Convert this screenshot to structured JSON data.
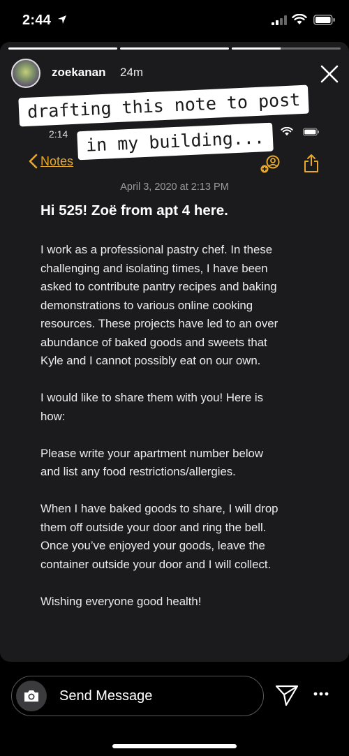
{
  "status_bar": {
    "time": "2:44"
  },
  "story": {
    "progress": [
      1.0,
      1.0,
      0.45
    ],
    "username": "zoekanan",
    "time_ago": "24m",
    "stickers": [
      "drafting this note to post",
      "in my building..."
    ]
  },
  "inner_screen": {
    "time": "2:14",
    "back_label": "Notes",
    "date": "April 3, 2020 at 2:13 PM",
    "title": "Hi 525! Zoë from apt 4 here.",
    "paragraphs": [
      "I work as a professional pastry chef. In these\nchallenging and isolating times, I have been\nasked to contribute pantry recipes and baking\ndemonstrations to various online cooking\nresources. These projects have led to an over\nabundance of baked goods and sweets that\nKyle and I cannot possibly eat on our own.",
      "I would like to share them with you! Here is\nhow:",
      "Please write your apartment number below\nand list any food restrictions/allergies.",
      "When I have baked goods to share, I will drop\nthem off outside your door and ring the bell.\nOnce you’ve enjoyed your goods, leave the\ncontainer outside your door and I will collect.",
      "Wishing everyone good health!"
    ]
  },
  "bottom_bar": {
    "message_placeholder": "Send Message"
  },
  "colors": {
    "accent": "#e8a92a",
    "card_bg": "#1b1b1d"
  }
}
